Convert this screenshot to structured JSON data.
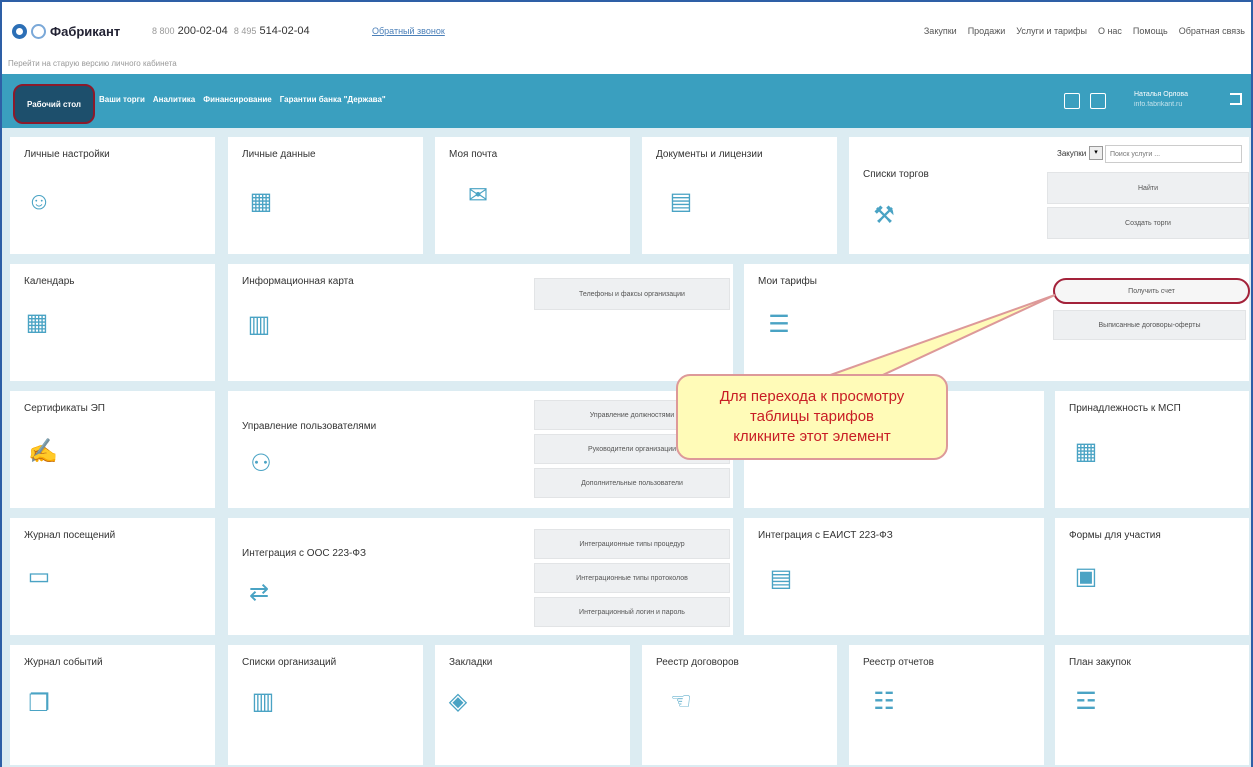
{
  "header": {
    "brand": "Фабрикант",
    "phone1_prefix": "8 800",
    "phone1": "200-02-04",
    "phone2_prefix": "8 495",
    "phone2": "514-02-04",
    "callback": "Обратный звонок",
    "nav": [
      "Закупки",
      "Продажи",
      "Услуги и тарифы",
      "О нас",
      "Помощь",
      "Обратная связь"
    ],
    "old_version_link": "Перейти на старую версию личного кабинета"
  },
  "toolbar": {
    "tabs": [
      "Рабочий стол",
      "Ваши торги",
      "Аналитика",
      "Финансирование",
      "Гарантии банка \"Держава\""
    ],
    "user_name": "Наталья Орлова",
    "user_sub": "info.fabrikant.ru"
  },
  "tiles": {
    "personal_settings": "Личные настройки",
    "personal_data": "Личные данные",
    "my_mail": "Моя почта",
    "documents": "Документы и лицензии",
    "trade_lists": "Списки торгов",
    "purchases_label": "Закупки",
    "search_placeholder": "Поиск услуги ...",
    "find": "Найти",
    "create_trade": "Создать торги",
    "calendar": "Календарь",
    "info_card": "Информационная карта",
    "phones_faxes": "Телефоны и факсы организации",
    "my_tariffs": "Мои тарифы",
    "get_invoice": "Получить счет",
    "offer_contracts": "Выписанные договоры-оферты",
    "certificates": "Сертификаты ЭП",
    "user_management": "Управление пользователями",
    "manage_positions": "Управление должностями",
    "org_heads": "Руководители организации",
    "extra_users": "Дополнительные пользователи",
    "msp": "Принадлежность к МСП",
    "visit_log": "Журнал посещений",
    "oos_integration": "Интеграция с ООС 223-ФЗ",
    "int_procedure_types": "Интеграционные типы процедур",
    "int_protocol_types": "Интеграционные типы протоколов",
    "int_login": "Интеграционный логин и пароль",
    "eaist": "Интеграция с ЕАИСТ 223-ФЗ",
    "forms": "Формы для участия",
    "event_log": "Журнал событий",
    "org_lists": "Списки организаций",
    "bookmarks": "Закладки",
    "contracts_registry": "Реестр договоров",
    "reports_registry": "Реестр отчетов",
    "purchase_plan": "План закупок"
  },
  "callout": {
    "line1": "Для перехода к просмотру",
    "line2": "таблицы тарифов",
    "line3": "кликните этот элемент"
  },
  "colors": {
    "accent": "#3a9fbf",
    "active_tab": "#1d4f6c",
    "highlight_border": "#a3223a",
    "callout_bg": "#fffbb8",
    "callout_text": "#c81d25"
  }
}
